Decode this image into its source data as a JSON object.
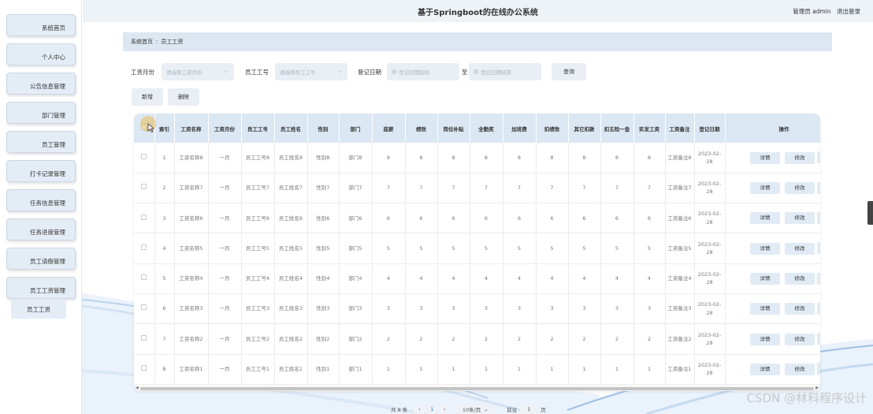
{
  "header": {
    "title": "基于Springboot的在线办公系统",
    "user": "管理员 admin",
    "logout": "退出登录"
  },
  "sidebar": {
    "items": [
      {
        "label": "系统首页"
      },
      {
        "label": "个人中心"
      },
      {
        "label": "公告信息管理"
      },
      {
        "label": "部门管理"
      },
      {
        "label": "员工管理"
      },
      {
        "label": "打卡记录管理"
      },
      {
        "label": "任务信息管理"
      },
      {
        "label": "任务进度管理"
      },
      {
        "label": "员工请假管理"
      },
      {
        "label": "员工工资管理"
      }
    ],
    "submenu": {
      "label": "员工工资"
    }
  },
  "breadcrumb": {
    "home": "系统首页",
    "sep": "ː",
    "current": "员工工资"
  },
  "search": {
    "month_label": "工资月份",
    "month_placeholder": "请选择工资月份",
    "empno_label": "员工工号",
    "empno_placeholder": "请选择员工工号",
    "date_label": "登记日期",
    "date_start_placeholder": "登记日期起始",
    "to_label": "至",
    "date_end_placeholder": "登记日期结束",
    "query_button": "查询",
    "add_button": "新增",
    "delete_button": "删除"
  },
  "table": {
    "headers": [
      "",
      "索引",
      "工资名称",
      "工资月份",
      "员工工号",
      "员工姓名",
      "性别",
      "部门",
      "底薪",
      "绩效",
      "岗位补贴",
      "全勤奖",
      "加班费",
      "扣绩效",
      "其它扣款",
      "扣五险一金",
      "实发工资",
      "工资备注",
      "登记日期",
      "操作"
    ],
    "rows": [
      {
        "idx": "1",
        "name": "工资名称8",
        "month": "一月",
        "empno": "员工工号8",
        "empname": "员工姓名8",
        "sex": "性别8",
        "dept": "部门8",
        "v": "8",
        "remark": "工资备注8",
        "date": "2023-02-28"
      },
      {
        "idx": "2",
        "name": "工资名称7",
        "month": "一月",
        "empno": "员工工号7",
        "empname": "员工姓名7",
        "sex": "性别7",
        "dept": "部门7",
        "v": "7",
        "remark": "工资备注7",
        "date": "2023-02-28"
      },
      {
        "idx": "3",
        "name": "工资名称6",
        "month": "一月",
        "empno": "员工工号6",
        "empname": "员工姓名6",
        "sex": "性别6",
        "dept": "部门6",
        "v": "6",
        "remark": "工资备注6",
        "date": "2023-02-28"
      },
      {
        "idx": "4",
        "name": "工资名称5",
        "month": "一月",
        "empno": "员工工号5",
        "empname": "员工姓名5",
        "sex": "性别5",
        "dept": "部门5",
        "v": "5",
        "remark": "工资备注5",
        "date": "2023-02-28"
      },
      {
        "idx": "5",
        "name": "工资名称4",
        "month": "一月",
        "empno": "员工工号4",
        "empname": "员工姓名4",
        "sex": "性别4",
        "dept": "部门4",
        "v": "4",
        "remark": "工资备注4",
        "date": "2023-02-28"
      },
      {
        "idx": "6",
        "name": "工资名称3",
        "month": "一月",
        "empno": "员工工号3",
        "empname": "员工姓名3",
        "sex": "性别3",
        "dept": "部门3",
        "v": "3",
        "remark": "工资备注3",
        "date": "2023-02-28"
      },
      {
        "idx": "7",
        "name": "工资名称2",
        "month": "一月",
        "empno": "员工工号2",
        "empname": "员工姓名2",
        "sex": "性别2",
        "dept": "部门2",
        "v": "2",
        "remark": "工资备注2",
        "date": "2023-02-28"
      },
      {
        "idx": "8",
        "name": "工资名称1",
        "month": "一月",
        "empno": "员工工号1",
        "empname": "员工姓名1",
        "sex": "性别1",
        "dept": "部门1",
        "v": "1",
        "remark": "工资备注1",
        "date": "2023-02-28"
      }
    ],
    "detail_button": "详情",
    "edit_button": "修改"
  },
  "pagination": {
    "total": "共 8 条",
    "page": "1",
    "page_size": "10条/页",
    "goto_label": "前往",
    "goto_value": "1",
    "page_suffix": "页"
  },
  "watermark": "CSDN @林科程序设计"
}
